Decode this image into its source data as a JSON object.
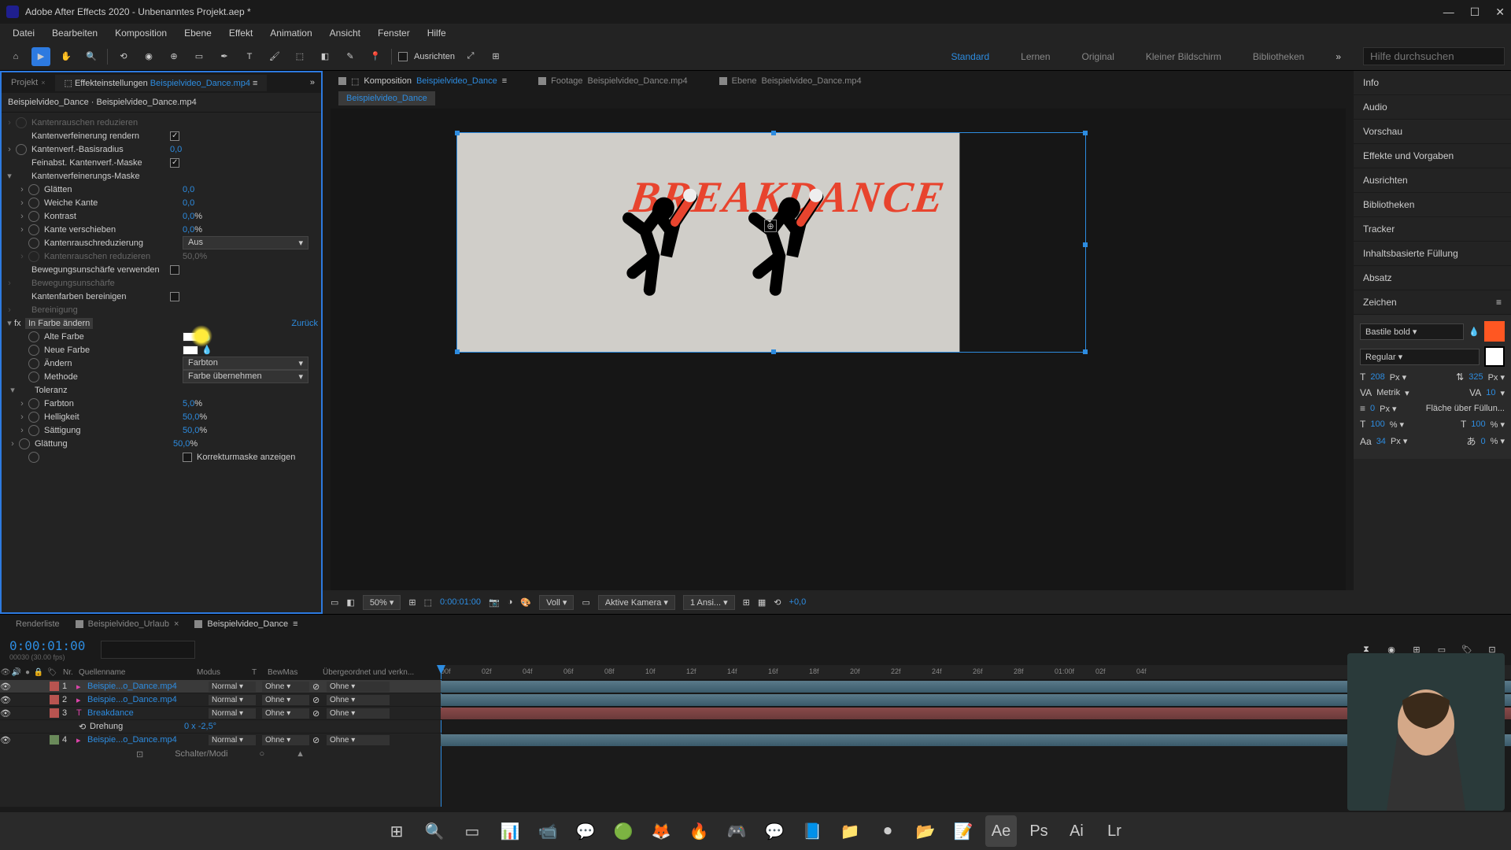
{
  "titlebar": {
    "title": "Adobe After Effects 2020 - Unbenanntes Projekt.aep *"
  },
  "menu": [
    "Datei",
    "Bearbeiten",
    "Komposition",
    "Ebene",
    "Effekt",
    "Animation",
    "Ansicht",
    "Fenster",
    "Hilfe"
  ],
  "toolbar": {
    "ausrichten": "Ausrichten",
    "search_ph": "Hilfe durchsuchen"
  },
  "workspaces": [
    "Standard",
    "Lernen",
    "Original",
    "Kleiner Bildschirm",
    "Bibliotheken"
  ],
  "projtab": {
    "projekt": "Projekt",
    "effekt": "Effekteinstellungen",
    "link": "Beispielvideo_Dance.mp4"
  },
  "breadcrumb": "Beispielvideo_Dance · Beispielvideo_Dance.mp4",
  "fx": {
    "r1": {
      "lbl": "Kantenrauschen reduzieren"
    },
    "r2": {
      "lbl": "Kantenverfeinerung rendern"
    },
    "r3": {
      "lbl": "Kantenverf.-Basisradius",
      "val": "0,0"
    },
    "r4": {
      "lbl": "Feinabst. Kantenverf.-Maske"
    },
    "r5": {
      "lbl": "Kantenverfeinerungs-Maske"
    },
    "r6": {
      "lbl": "Glätten",
      "val": "0,0"
    },
    "r7": {
      "lbl": "Weiche Kante",
      "val": "0,0"
    },
    "r8": {
      "lbl": "Kontrast",
      "val": "0,0"
    },
    "r9": {
      "lbl": "Kante verschieben",
      "val": "0,0"
    },
    "r10": {
      "lbl": "Kantenrauschreduzierung",
      "val": "Aus"
    },
    "r11": {
      "lbl": "Kantenrauschen reduzieren",
      "val": "50,0"
    },
    "r12": {
      "lbl": "Bewegungsunschärfe verwenden"
    },
    "r13": {
      "lbl": "Bewegungsunschärfe"
    },
    "r14": {
      "lbl": "Kantenfarben bereinigen"
    },
    "r15": {
      "lbl": "Bereinigung"
    },
    "effect_name": "In Farbe ändern",
    "reset": "Zurück",
    "r16": {
      "lbl": "Alte Farbe"
    },
    "r17": {
      "lbl": "Neue Farbe"
    },
    "r18": {
      "lbl": "Ändern",
      "val": "Farbton"
    },
    "r19": {
      "lbl": "Methode",
      "val": "Farbe übernehmen"
    },
    "r20": {
      "lbl": "Toleranz"
    },
    "r21": {
      "lbl": "Farbton",
      "val": "5,0"
    },
    "r22": {
      "lbl": "Helligkeit",
      "val": "50,0"
    },
    "r23": {
      "lbl": "Sättigung",
      "val": "50,0"
    },
    "r24": {
      "lbl": "Glättung",
      "val": "50,0"
    },
    "r25": {
      "lbl": "Korrekturmaske anzeigen"
    }
  },
  "comp": {
    "komp": "Komposition",
    "link": "Beispielvideo_Dance",
    "foot": "Footage",
    "foot_link": "Beispielvideo_Dance.mp4",
    "ebene": "Ebene",
    "ebene_link": "Beispielvideo_Dance.mp4",
    "bc": "Beispielvideo_Dance",
    "text": "BREAKDANCE"
  },
  "viewer": {
    "zoom": "50%",
    "time": "0:00:01:00",
    "res": "Voll",
    "cam": "Aktive Kamera",
    "views": "1 Ansi...",
    "exp": "+0,0"
  },
  "rpanel": [
    "Info",
    "Audio",
    "Vorschau",
    "Effekte und Vorgaben",
    "Ausrichten",
    "Bibliotheken",
    "Tracker",
    "Inhaltsbasierte Füllung",
    "Absatz"
  ],
  "char": {
    "title": "Zeichen",
    "font": "Bastile bold",
    "style": "Regular",
    "size": "208",
    "lead": "325",
    "kern": "Metrik",
    "track": "10",
    "baseline": "0",
    "stroke": "Fläche über Füllun...",
    "hscale": "100",
    "vscale": "100",
    "tsume": "34",
    "other": "0"
  },
  "timeline": {
    "tabs": {
      "render": "Renderliste",
      "urlaub": "Beispielvideo_Urlaub",
      "dance": "Beispielvideo_Dance"
    },
    "time": "0:00:01:00",
    "timesub": "00030 (30.00 fps)",
    "cols": {
      "nr": "Nr.",
      "name": "Quellenname",
      "mode": "Modus",
      "t": "T",
      "bewmas": "BewMas",
      "parent": "Übergeordnet und verkn..."
    },
    "layers": [
      {
        "nr": "1",
        "name": "Beispie...o_Dance.mp4",
        "mode": "Normal",
        "bm": "Ohne",
        "par": "Ohne",
        "color": "#b85450",
        "type": "vid"
      },
      {
        "nr": "2",
        "name": "Beispie...o_Dance.mp4",
        "mode": "Normal",
        "bm": "Ohne",
        "par": "Ohne",
        "color": "#b85450",
        "type": "vid"
      },
      {
        "nr": "3",
        "name": "Breakdance",
        "mode": "Normal",
        "bm": "Ohne",
        "par": "Ohne",
        "color": "#b85450",
        "type": "txt"
      },
      {
        "nr": "4",
        "name": "Beispie...o_Dance.mp4",
        "mode": "Normal",
        "bm": "Ohne",
        "par": "Ohne",
        "color": "#6a8a5a",
        "type": "vid"
      }
    ],
    "prop": {
      "name": "Drehung",
      "val": "0 x -2,5°"
    },
    "footer": "Schalter/Modi",
    "ruler": [
      "00f",
      "02f",
      "04f",
      "06f",
      "08f",
      "10f",
      "12f",
      "14f",
      "16f",
      "18f",
      "20f",
      "22f",
      "24f",
      "26f",
      "28f",
      "01:00f",
      "02f",
      "04f"
    ]
  },
  "taskbar_apps": [
    "⊞",
    "🔍",
    "▭",
    "📊",
    "📹",
    "💬",
    "🟢",
    "🦊",
    "🔥",
    "🎮",
    "💬",
    "📘",
    "📁",
    "⏺",
    "📂",
    "📝",
    "Ae",
    "Ps",
    "Ai",
    "Lr"
  ]
}
